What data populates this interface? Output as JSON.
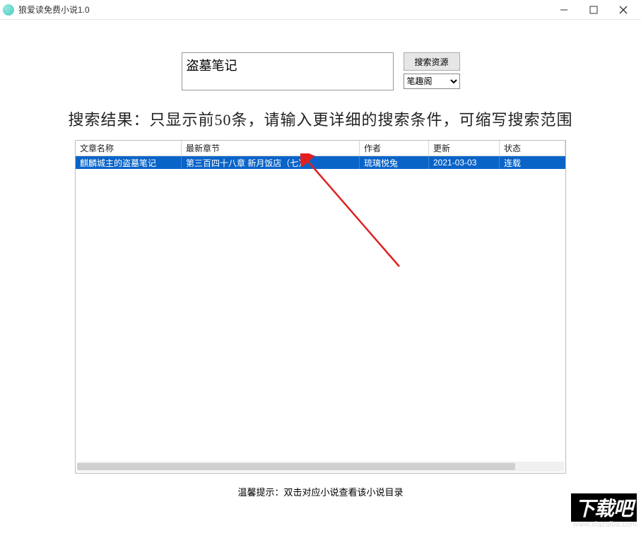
{
  "window": {
    "title": "狼爱读免费小说1.0"
  },
  "search": {
    "value": "盗墓笔记",
    "button": "搜索资源",
    "source_selected": "笔趣阁"
  },
  "hint_big": "搜索结果：只显示前50条，请输入更详细的搜索条件，可缩写搜索范围",
  "table": {
    "headers": {
      "name": "文章名称",
      "chapter": "最新章节",
      "author": "作者",
      "update": "更新",
      "status": "状态"
    },
    "rows": [
      {
        "name": "麒麟城主的盗墓笔记",
        "chapter": "第三百四十八章 新月饭店（七）",
        "author": "琉璃悦兔",
        "update": "2021-03-03",
        "status": "连载"
      }
    ]
  },
  "tip_bottom": "温馨提示：双击对应小说查看该小说目录",
  "watermark": {
    "big": "下载吧",
    "url": "www.xiazaiba.com"
  }
}
